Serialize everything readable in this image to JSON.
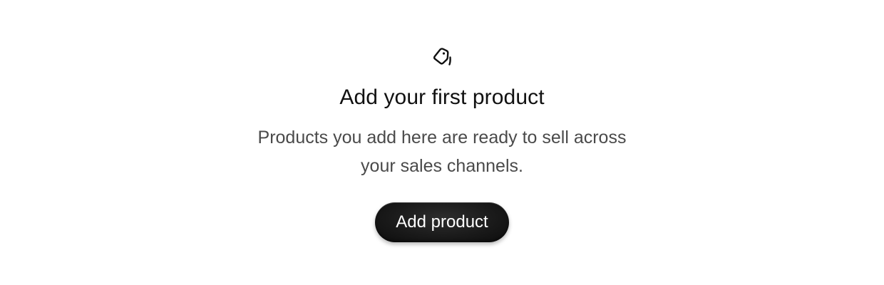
{
  "empty_state": {
    "icon": "tag-icon",
    "title": "Add your first product",
    "description_line1": "Products you add here are ready to sell across",
    "description_line2": "your sales channels.",
    "button_label": "Add product"
  },
  "colors": {
    "background": "#ffffff",
    "title": "#111111",
    "description": "#4a4a4a",
    "button_bg": "#1a1a1a",
    "button_text": "#ffffff"
  }
}
